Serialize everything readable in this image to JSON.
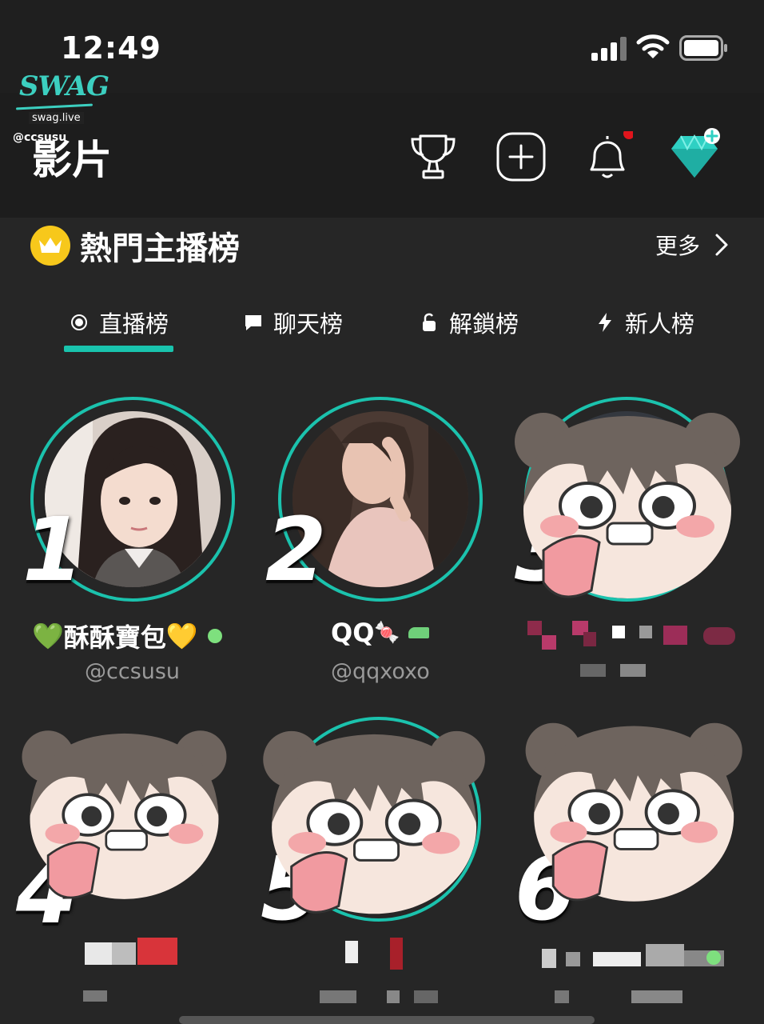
{
  "status_bar": {
    "time": "12:49"
  },
  "watermark": {
    "logo": "SWAG",
    "url": "swag.live",
    "handle": "@ccsusu"
  },
  "header": {
    "title": "影片",
    "icons": [
      "trophy-icon",
      "add-icon",
      "bell-icon",
      "diamond-icon"
    ],
    "notification_dot_color": "#e0141c"
  },
  "ranking": {
    "title": "熱門主播榜",
    "more_label": "更多",
    "tabs": [
      {
        "label": "直播榜",
        "icon": "live-icon",
        "active": true
      },
      {
        "label": "聊天榜",
        "icon": "chat-icon",
        "active": false
      },
      {
        "label": "解鎖榜",
        "icon": "unlock-icon",
        "active": false
      },
      {
        "label": "新人榜",
        "icon": "lightning-icon",
        "active": false
      }
    ],
    "accent_color": "#19c3ad",
    "streamers": [
      {
        "rank": "1",
        "name": "酥酥寶包",
        "name_prefix": "💚",
        "name_suffix": "💛",
        "handle": "@ccsusu",
        "online": true
      },
      {
        "rank": "2",
        "name": "QQ",
        "name_suffix": "🍬",
        "handle": "@qqxoxo",
        "online": false
      },
      {
        "rank": "3",
        "name": "",
        "handle": "",
        "obscured": true
      },
      {
        "rank": "4",
        "name": "",
        "handle": "",
        "obscured": true
      },
      {
        "rank": "5",
        "name": "",
        "handle": "",
        "obscured": true
      },
      {
        "rank": "6",
        "name": "",
        "handle": "",
        "obscured": true
      }
    ]
  }
}
